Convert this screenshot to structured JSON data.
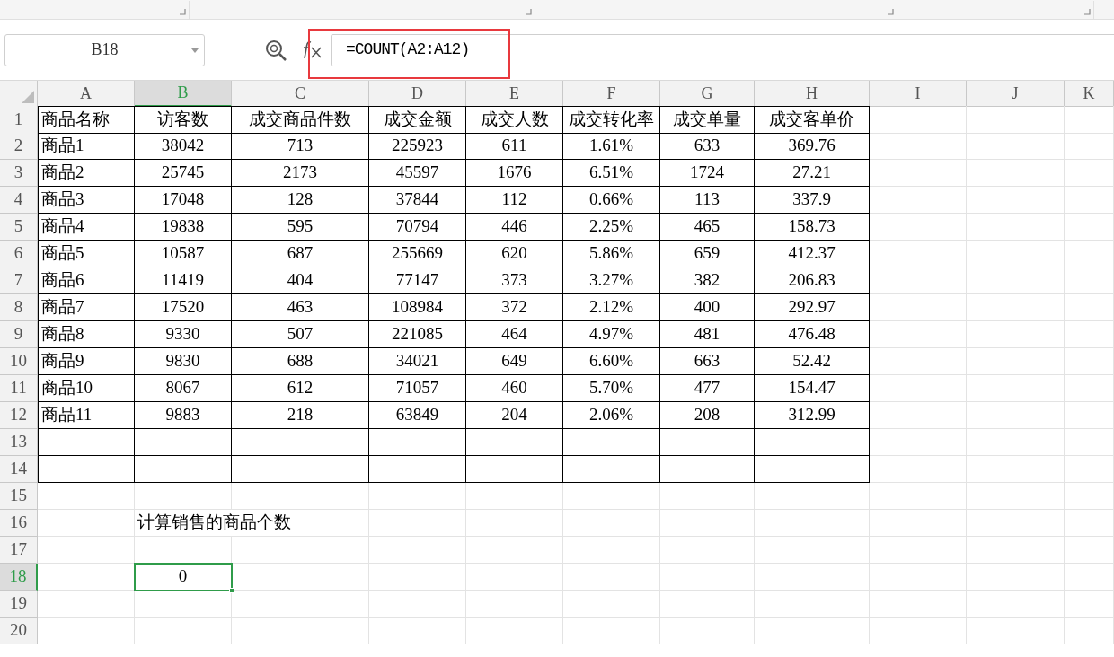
{
  "name_box": {
    "value": "B18"
  },
  "formula_bar": {
    "value": "=COUNT(A2:A12)",
    "highlighted": true
  },
  "columns": [
    {
      "label": "A",
      "selected": false
    },
    {
      "label": "B",
      "selected": true
    },
    {
      "label": "C",
      "selected": false
    },
    {
      "label": "D",
      "selected": false
    },
    {
      "label": "E",
      "selected": false
    },
    {
      "label": "F",
      "selected": false
    },
    {
      "label": "G",
      "selected": false
    },
    {
      "label": "H",
      "selected": false
    },
    {
      "label": "I",
      "selected": false
    },
    {
      "label": "J",
      "selected": false
    },
    {
      "label": "K",
      "selected": false
    }
  ],
  "row_headers": [
    {
      "label": "1",
      "selected": false
    },
    {
      "label": "2",
      "selected": false
    },
    {
      "label": "3",
      "selected": false
    },
    {
      "label": "4",
      "selected": false
    },
    {
      "label": "5",
      "selected": false
    },
    {
      "label": "6",
      "selected": false
    },
    {
      "label": "7",
      "selected": false
    },
    {
      "label": "8",
      "selected": false
    },
    {
      "label": "9",
      "selected": false
    },
    {
      "label": "10",
      "selected": false
    },
    {
      "label": "11",
      "selected": false
    },
    {
      "label": "12",
      "selected": false
    },
    {
      "label": "13",
      "selected": false
    },
    {
      "label": "14",
      "selected": false
    },
    {
      "label": "15",
      "selected": false
    },
    {
      "label": "16",
      "selected": false
    },
    {
      "label": "17",
      "selected": false
    },
    {
      "label": "18",
      "selected": true
    },
    {
      "label": "19",
      "selected": false
    },
    {
      "label": "20",
      "selected": false
    }
  ],
  "table": {
    "rows": [
      [
        "商品名称",
        "访客数",
        "成交商品件数",
        "成交金额",
        "成交人数",
        "成交转化率",
        "成交单量",
        "成交客单价"
      ],
      [
        "商品1",
        "38042",
        "713",
        "225923",
        "611",
        "1.61%",
        "633",
        "369.76"
      ],
      [
        "商品2",
        "25745",
        "2173",
        "45597",
        "1676",
        "6.51%",
        "1724",
        "27.21"
      ],
      [
        "商品3",
        "17048",
        "128",
        "37844",
        "112",
        "0.66%",
        "113",
        "337.9"
      ],
      [
        "商品4",
        "19838",
        "595",
        "70794",
        "446",
        "2.25%",
        "465",
        "158.73"
      ],
      [
        "商品5",
        "10587",
        "687",
        "255669",
        "620",
        "5.86%",
        "659",
        "412.37"
      ],
      [
        "商品6",
        "11419",
        "404",
        "77147",
        "373",
        "3.27%",
        "382",
        "206.83"
      ],
      [
        "商品7",
        "17520",
        "463",
        "108984",
        "372",
        "2.12%",
        "400",
        "292.97"
      ],
      [
        "商品8",
        "9330",
        "507",
        "221085",
        "464",
        "4.97%",
        "481",
        "476.48"
      ],
      [
        "商品9",
        "9830",
        "688",
        "34021",
        "649",
        "6.60%",
        "663",
        "52.42"
      ],
      [
        "商品10",
        "8067",
        "612",
        "71057",
        "460",
        "5.70%",
        "477",
        "154.47"
      ],
      [
        "商品11",
        "9883",
        "218",
        "63849",
        "204",
        "2.06%",
        "208",
        "312.99"
      ]
    ]
  },
  "note": "计算销售的商品个数",
  "result": "0"
}
